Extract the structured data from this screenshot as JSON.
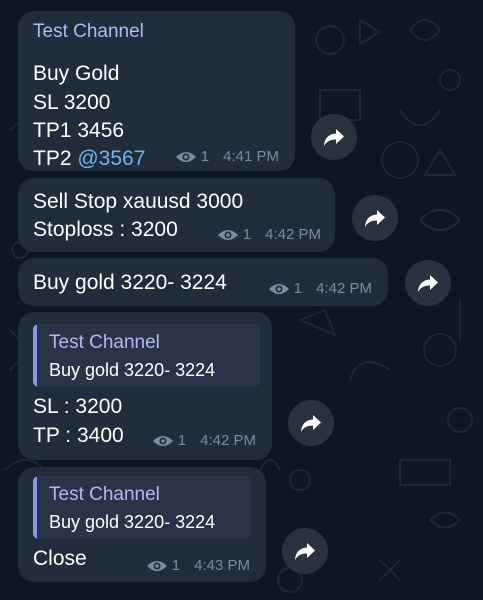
{
  "channel_name": "Test Channel",
  "messages": [
    {
      "sender": "Test Channel",
      "line1": "Buy Gold",
      "line2": "SL 3200",
      "line3": "TP1 3456",
      "line4_prefix": "TP2 ",
      "line4_mention": "@3567",
      "views": "1",
      "time": "4:41 PM"
    },
    {
      "line1": "Sell Stop xauusd 3000",
      "line2": "Stoploss : 3200",
      "views": "1",
      "time": "4:42 PM"
    },
    {
      "line1": "Buy gold 3220- 3224",
      "views": "1",
      "time": "4:42 PM"
    },
    {
      "reply_name": "Test Channel",
      "reply_text": "Buy gold 3220- 3224",
      "line1": "SL : 3200",
      "line2": "TP : 3400",
      "views": "1",
      "time": "4:42 PM"
    },
    {
      "reply_name": "Test Channel",
      "reply_text": "Buy gold 3220- 3224",
      "line1": "Close",
      "views": "1",
      "time": "4:43 PM"
    }
  ],
  "icons": {
    "views": "eye-icon",
    "share": "share-arrow-icon"
  },
  "colors": {
    "background": "#0e1621",
    "bubble": "#212d3b",
    "sender": "#b1b8f7",
    "mention": "#6fb3f2",
    "meta": "#7c8b9c",
    "reply_bar": "#8f95ee"
  }
}
